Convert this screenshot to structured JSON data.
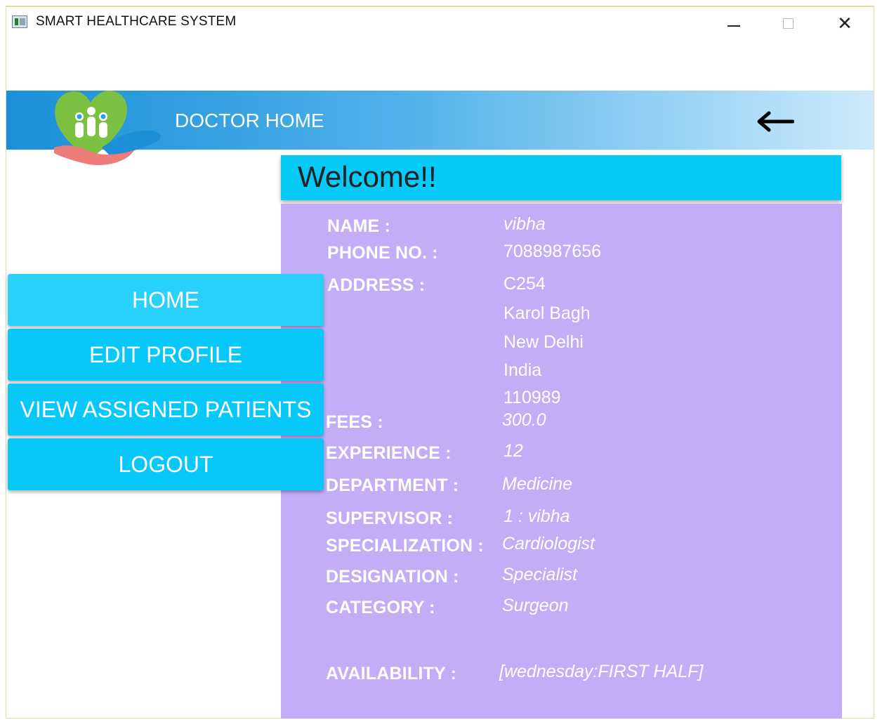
{
  "window": {
    "title": "SMART HEALTHCARE SYSTEM"
  },
  "header": {
    "title": "DOCTOR HOME",
    "back_icon": "arrow-left-icon"
  },
  "nav": {
    "home": "HOME",
    "edit_profile": "EDIT PROFILE",
    "view_patients": "VIEW ASSIGNED PATIENTS",
    "logout": "LOGOUT"
  },
  "welcome": "Welcome!!",
  "profile": {
    "name_label": "NAME :",
    "name": "vibha",
    "phone_label": "PHONE NO. :",
    "phone": "7088987656",
    "address_label": "ADDRESS :",
    "address_lines": [
      "C254",
      "Karol Bagh",
      "New Delhi",
      "India",
      "110989"
    ],
    "fees_label": "FEES :",
    "fees": "300.0",
    "experience_label": "EXPERIENCE :",
    "experience": "12",
    "department_label": "DEPARTMENT :",
    "department": "Medicine",
    "supervisor_label": "SUPERVISOR :",
    "supervisor": "1 : vibha",
    "specialization_label": "SPECIALIZATION :",
    "specialization": "Cardiologist",
    "designation_label": "DESIGNATION :",
    "designation": "Specialist",
    "category_label": "CATEGORY :",
    "category": "Surgeon",
    "availability_label": "AVAILABILITY :",
    "availability": "[wednesday:FIRST HALF]"
  },
  "colors": {
    "nav_button": "#07c8f8",
    "panel": "#c2adf6",
    "header_blue": "#1a8fd8"
  }
}
